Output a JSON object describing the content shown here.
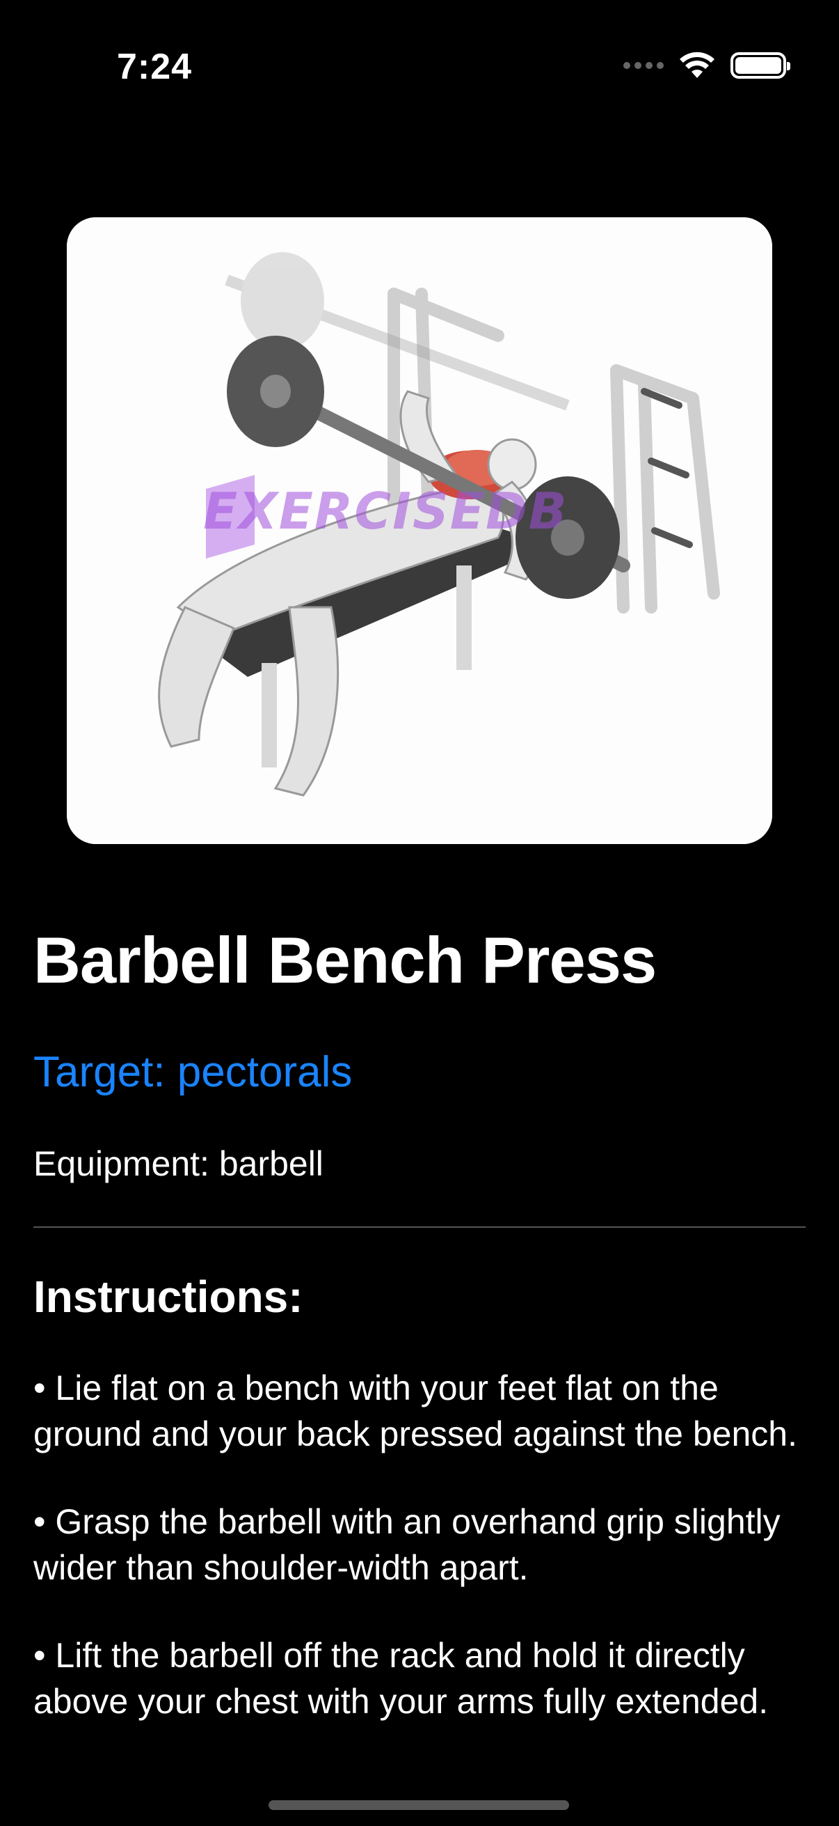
{
  "status_bar": {
    "time": "7:24",
    "icons": [
      "signal-dots-icon",
      "wifi-icon",
      "battery-icon"
    ]
  },
  "exercise": {
    "image_watermark": "EXERCISEDB",
    "title": "Barbell Bench Press",
    "target": "Target: pectorals",
    "equipment": "Equipment: barbell"
  },
  "instructions": {
    "heading": "Instructions:",
    "items": [
      "• Lie flat on a bench with your feet flat on the ground and your back pressed against the bench.",
      "• Grasp the barbell with an overhand grip slightly wider than shoulder-width apart.",
      "• Lift the barbell off the rack and hold it directly above your chest with your arms fully extended."
    ]
  },
  "colors": {
    "background": "#000000",
    "accent": "#1a84ff",
    "text": "#ffffff"
  }
}
